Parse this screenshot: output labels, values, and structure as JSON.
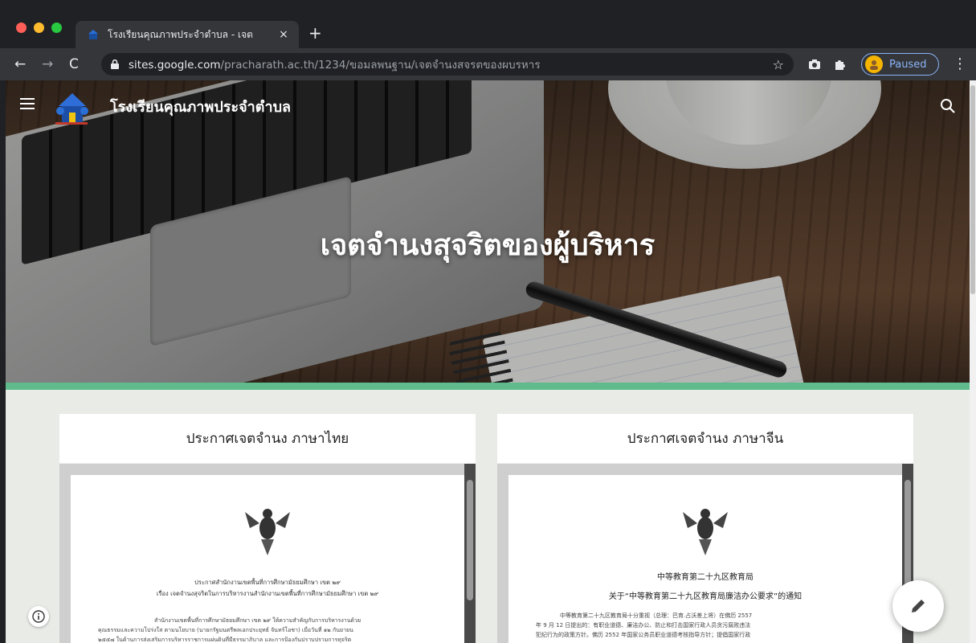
{
  "browser": {
    "tab": {
      "title": "โรงเรียนคุณภาพประจำตำบล - เจต",
      "close": "×"
    },
    "new_tab": "+",
    "address_bar": {
      "host": "sites.google.com",
      "path": "/pracharath.ac.th/1234/ขอมลพนฐาน/เจตจำนงสจรตของผบรหาร"
    },
    "profile": {
      "label": "Paused"
    },
    "icons": {
      "back": "back-arrow-icon",
      "forward": "forward-arrow-icon",
      "reload": "reload-icon",
      "lock": "lock-icon",
      "bookmark": "star-icon",
      "camera": "camera-icon",
      "extensions": "puzzle-icon",
      "menu": "kebab-menu-icon"
    }
  },
  "site": {
    "title": "โรงเรียนคุณภาพประจำตำบล",
    "page_title": "เจตจำนงสุจริตของผู้บริหาร",
    "accent_color": "#5fbb8c"
  },
  "cards": [
    {
      "title": "ประกาศเจตจำนง ภาษาไทย",
      "doc": {
        "heading": "ประกาศสำนักงานเขตพื้นที่การศึกษามัธยมศึกษา เขต ๒๙",
        "subject": "เรื่อง เจตจำนงสุจริตในการบริหารงานสำนักงานเขตพื้นที่การศึกษามัธยมศึกษา เขต ๒๙",
        "body": [
          "สำนักงานเขตพื้นที่การศึกษามัธยมศึกษา เขต ๒๙ ให้ความสำคัญกับการบริหารงานด้วย",
          "คุณธรรมและความโปร่งใส ตามนโยบาย (นายกรัฐมนตรีพลเอกประยุทธ์ จันทร์โอชา) เมื่อวันที่ ๑๒ กันยายน",
          "๒๕๕๗ ในด้านการส่งเสริมการบริหารราชการแผ่นดินที่มีธรรมาภิบาล และการป้องกันปราบปรามการทุจริต"
        ]
      }
    },
    {
      "title": "ประกาศเจตจำนง ภาษาจีน",
      "doc": {
        "heading": "中等教育第二十九区教育局",
        "subject": "关于“中等教育第二十九区教育局廉洁办公要求”的通知",
        "body": [
          "中等教育第二十九区教育局十分重视（总理：巴育.占沃差上将）在佛历 2557",
          "年 9 月 12 日提出的：有职业道德、廉洁办公、防止和打击国家行政人员贪污腐败违法",
          "犯纪行为的政策方针。佛历 2552 年国家公务员职业道德考核指导方针；提倡国家行政"
        ]
      }
    }
  ]
}
